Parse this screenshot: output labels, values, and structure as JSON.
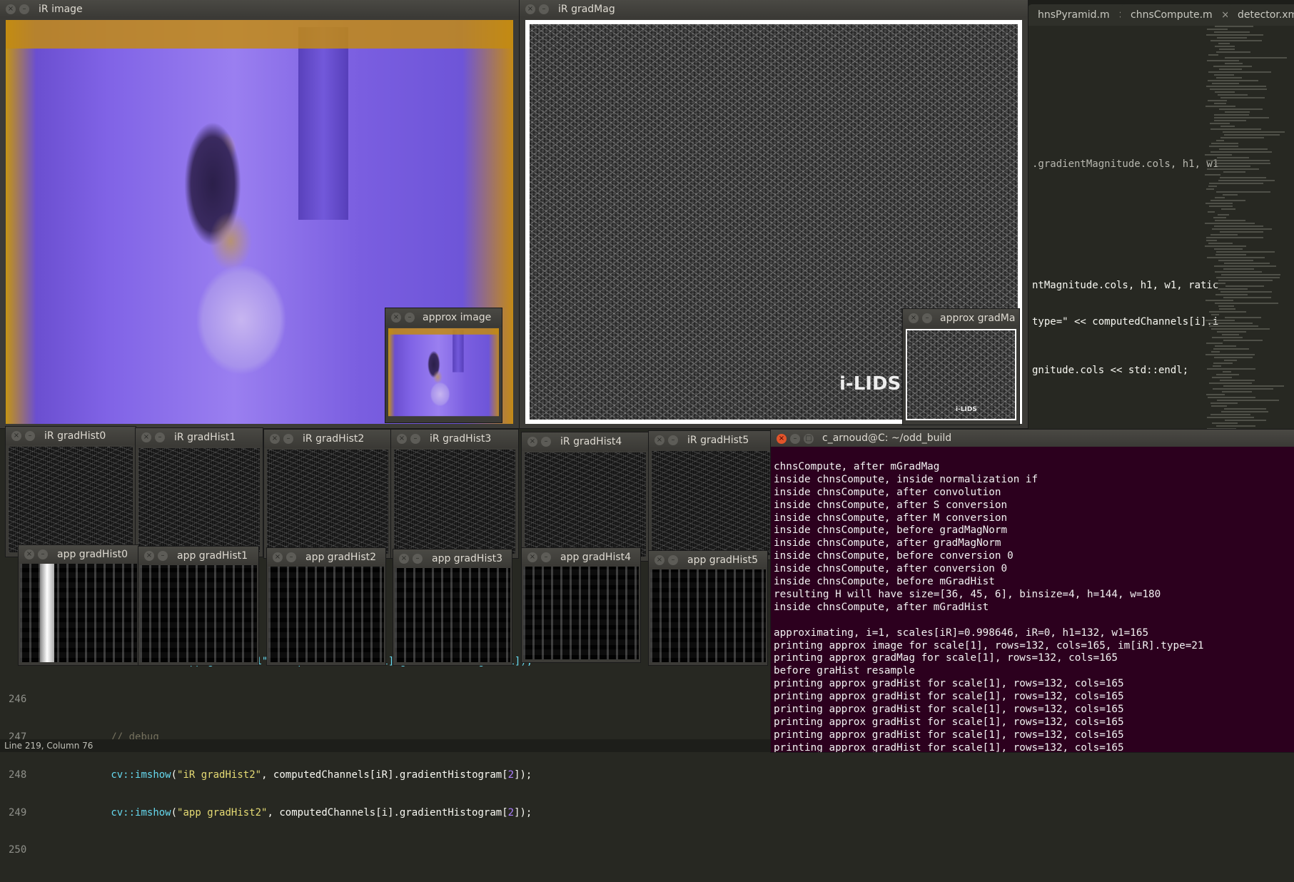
{
  "editor": {
    "tabs": [
      {
        "label": "hnsPyramid.m",
        "close": "×"
      },
      {
        "label": "chnsCompute.m",
        "close": "×"
      },
      {
        "label": "detector.xml",
        "close": "×"
      }
    ],
    "right_snippets": [
      ".gradientMagnitude.cols, h1, w1",
      "ntMagnitude.cols, h1, w1, ratic",
      "type=\" << computedChannels[i].i",
      "gnitude.cols << std::endl;"
    ],
    "behind_snippets": [
      "::imshow(\"app gradHist1\", computedChannels[i].gradientHistogram[1]);"
    ],
    "lines": [
      {
        "num": "246",
        "text": ""
      },
      {
        "num": "247",
        "comment": "// debug"
      },
      {
        "num": "248",
        "fn": "cv::imshow",
        "open": "(",
        "str": "\"iR gradHist2\"",
        "rest": ", computedChannels[iR].gradientHistogram[",
        "idx": "2",
        "close": "]);"
      },
      {
        "num": "249",
        "fn": "cv::imshow",
        "open": "(",
        "str": "\"app gradHist2\"",
        "rest": ", computedChannels[i].gradientHistogram[",
        "idx": "2",
        "close": "]);"
      },
      {
        "num": "250",
        "text": ""
      }
    ],
    "status": "Line 219, Column 76"
  },
  "windows": {
    "ir_image": {
      "title": "iR image"
    },
    "ir_gradmag": {
      "title": "iR gradMag"
    },
    "approx_image": {
      "title": "approx image"
    },
    "approx_gradmag": {
      "title": "approx gradMa"
    },
    "ir_hists": [
      "iR gradHist0",
      "iR gradHist1",
      "iR gradHist2",
      "iR gradHist3",
      "iR gradHist4",
      "iR gradHist5"
    ],
    "app_hists": [
      "app gradHist0",
      "app gradHist1",
      "app gradHist2",
      "app gradHist3",
      "app gradHist4",
      "app gradHist5"
    ],
    "watermark": "i-LIDS",
    "watermark_big": "i-LIDS (A"
  },
  "terminal": {
    "title": "c_arnoud@C: ~/odd_build",
    "lines": [
      "chnsCompute, after mGradMag",
      "inside chnsCompute, inside normalization if",
      "inside chnsCompute, after convolution",
      "inside chnsCompute, after S conversion",
      "inside chnsCompute, after M conversion",
      "inside chnsCompute, before gradMagNorm",
      "inside chnsCompute, after gradMagNorm",
      "inside chnsCompute, before conversion 0",
      "inside chnsCompute, after conversion 0",
      "inside chnsCompute, before mGradHist",
      "resulting H will have size=[36, 45, 6], binsize=4, h=144, w=180",
      "inside chnsCompute, after mGradHist",
      "",
      "approximating, i=1, scales[iR]=0.998646, iR=0, h1=132, w1=165",
      "printing approx image for scale[1], rows=132, cols=165, im[iR].type=21",
      "printing approx gradMag for scale[1], rows=132, cols=165",
      "before graHist resample",
      "printing approx gradHist for scale[1], rows=132, cols=165",
      "printing approx gradHist for scale[1], rows=132, cols=165",
      "printing approx gradHist for scale[1], rows=132, cols=165",
      "printing approx gradHist for scale[1], rows=132, cols=165",
      "printing approx gradHist for scale[1], rows=132, cols=165",
      "printing approx gradHist for scale[1], rows=132, cols=165"
    ],
    "cursor": "█"
  },
  "window_controls": {
    "close": "×",
    "min": "–",
    "max": "□"
  }
}
